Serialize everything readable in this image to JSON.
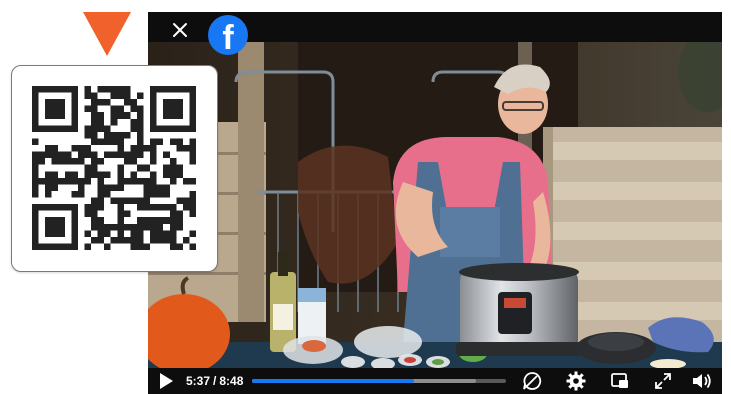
{
  "player": {
    "close_icon": "close-icon",
    "facebook_glyph": "f",
    "current_time": "5:37",
    "separator": "/",
    "duration": "8:48",
    "progress": 0.638,
    "buffered": 0.88,
    "icons": [
      "play-icon",
      "captions-off-icon",
      "gear-icon",
      "miniplayer-icon",
      "fullscreen-icon",
      "volume-icon"
    ],
    "colors": {
      "accent": "#1877f2",
      "bar": "#0d0d0d"
    }
  },
  "qr_card": {
    "arrow_color": "#f0612b",
    "icon": "qr-code-icon"
  }
}
